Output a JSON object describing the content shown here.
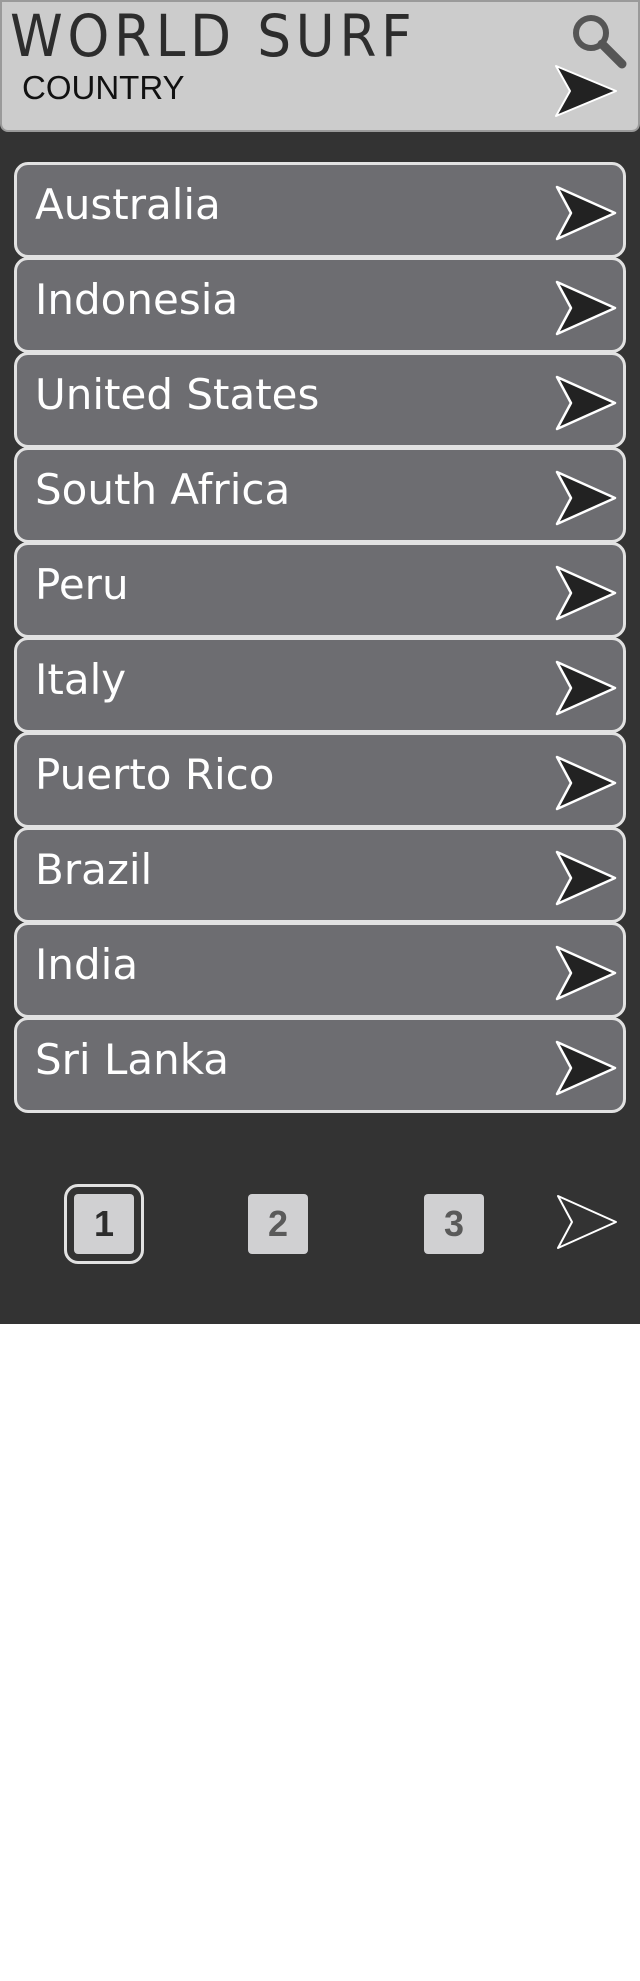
{
  "header": {
    "app_title": "WORLD SURF",
    "section_label": "COUNTRY",
    "search_icon": "search-icon",
    "next_icon": "arrow-right-icon"
  },
  "countries": [
    {
      "label": "Australia"
    },
    {
      "label": "Indonesia"
    },
    {
      "label": "United States"
    },
    {
      "label": "South Africa"
    },
    {
      "label": "Peru"
    },
    {
      "label": "Italy"
    },
    {
      "label": "Puerto Rico"
    },
    {
      "label": "Brazil"
    },
    {
      "label": "India"
    },
    {
      "label": "Sri Lanka"
    }
  ],
  "pagination": {
    "pages": [
      "1",
      "2",
      "3"
    ],
    "current_page": "1",
    "next_icon": "arrow-right-icon"
  },
  "colors": {
    "background": "#333333",
    "header": "#cccccc",
    "row": "#6d6d71",
    "row_border": "#e2e2e2",
    "page_button": "#d0d0d2"
  }
}
